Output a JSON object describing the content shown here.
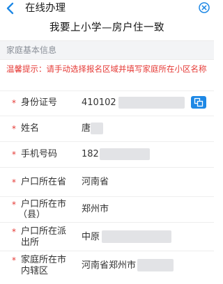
{
  "header": {
    "title": "在线办理",
    "back_icon": "chevron-left-icon",
    "close_icon": "close-circle-icon"
  },
  "page_title": "我要上小学—房户住一致",
  "section": {
    "title": "家庭基本信息"
  },
  "notice": "温馨提示：请手动选择报名区域并填写家庭所在小区名称",
  "colors": {
    "required": "#e53935",
    "accent": "#1e88e5",
    "section_bg": "#f3f4f6"
  },
  "fields": {
    "id_number": {
      "required": "*",
      "label": "身份证号",
      "value": "410102",
      "action_icon": "copy-icon"
    },
    "name": {
      "required": "*",
      "label": "姓名",
      "value": "唐"
    },
    "phone": {
      "required": "*",
      "label": "手机号码",
      "value": "182"
    },
    "hukou_province": {
      "required": "*",
      "label": "户口所在省",
      "value": "河南省"
    },
    "hukou_city": {
      "required": "*",
      "label_line1": "户口所在市",
      "label_line2": "（县）",
      "value": "郑州市"
    },
    "hukou_station": {
      "required": "*",
      "label_line1": "户口所在派",
      "label_line2": "出所",
      "value": "中原"
    },
    "home_district": {
      "required": "*",
      "label_line1": "家庭所在市",
      "label_line2": "内辖区",
      "value": "河南省郑州市"
    }
  }
}
